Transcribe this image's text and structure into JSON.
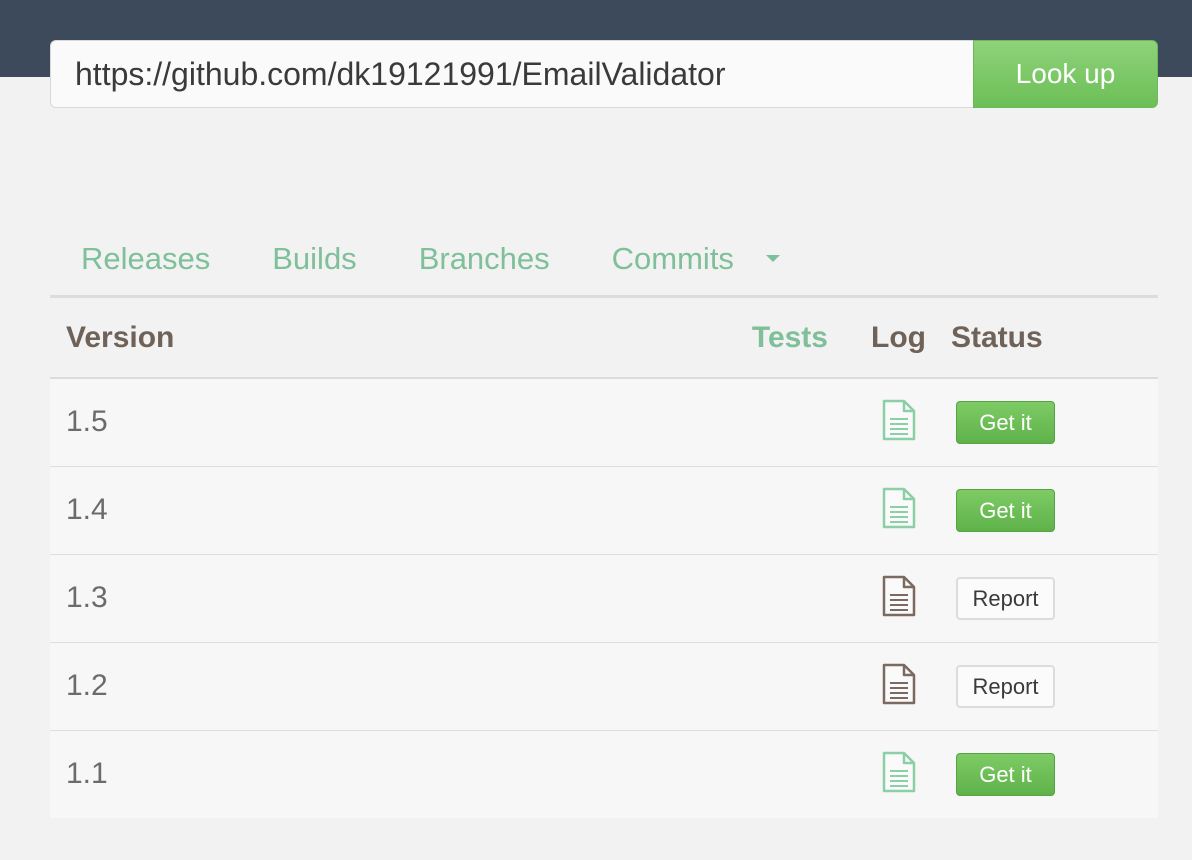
{
  "search": {
    "url_value": "https://github.com/dk19121991/EmailValidator",
    "button_label": "Look up"
  },
  "tabs": [
    {
      "label": "Releases"
    },
    {
      "label": "Builds"
    },
    {
      "label": "Branches"
    },
    {
      "label": "Commits"
    }
  ],
  "table": {
    "headers": {
      "version": "Version",
      "tests": "Tests",
      "log": "Log",
      "status": "Status"
    },
    "rows": [
      {
        "version": "1.5",
        "log_icon": "log-file-icon",
        "log_color": "#8ccfa6",
        "status": "Get it",
        "status_type": "get"
      },
      {
        "version": "1.4",
        "log_icon": "log-file-icon",
        "log_color": "#8ccfa6",
        "status": "Get it",
        "status_type": "get"
      },
      {
        "version": "1.3",
        "log_icon": "log-file-icon",
        "log_color": "#7a6a62",
        "status": "Report",
        "status_type": "report"
      },
      {
        "version": "1.2",
        "log_icon": "log-file-icon",
        "log_color": "#7a6a62",
        "status": "Report",
        "status_type": "report"
      },
      {
        "version": "1.1",
        "log_icon": "log-file-icon",
        "log_color": "#8ccfa6",
        "status": "Get it",
        "status_type": "get"
      }
    ]
  },
  "colors": {
    "topbar": "#3d4a5c",
    "accent_green": "#7fbf9a",
    "button_green": "#6cbf57",
    "log_ok": "#8ccfa6",
    "log_fail": "#7a6a62"
  }
}
